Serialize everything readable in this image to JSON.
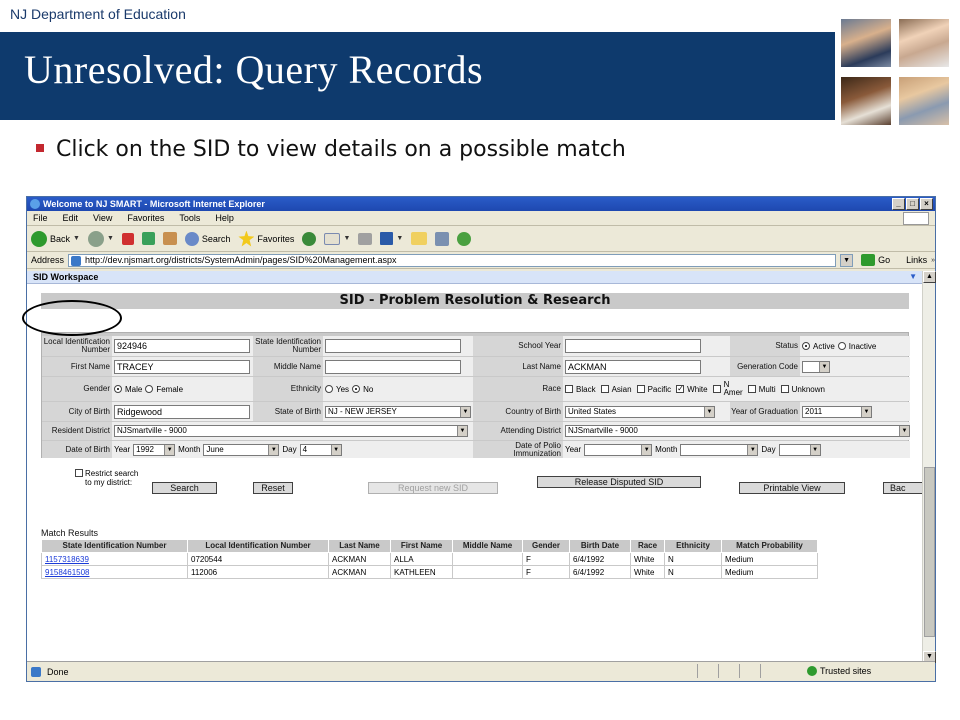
{
  "slide": {
    "header_small": "NJ Department of Education",
    "title": "Unresolved:  Query Records",
    "bullet": "Click on the SID to view details on a possible match"
  },
  "browser": {
    "title": "Welcome to NJ SMART - Microsoft Internet Explorer",
    "window_buttons": [
      "_",
      "□",
      "×"
    ],
    "menu": [
      "File",
      "Edit",
      "View",
      "Favorites",
      "Tools",
      "Help"
    ],
    "toolbar": {
      "back": "Back",
      "search": "Search",
      "favorites": "Favorites"
    },
    "address": {
      "label": "Address",
      "url": "http://dev.njsmart.org/districts/SystemAdmin/pages/SID%20Management.aspx",
      "go": "Go",
      "links": "Links"
    },
    "status": {
      "text": "Done",
      "zone": "Trusted sites"
    }
  },
  "workspace": {
    "bar_title": "SID Workspace",
    "page_title": "SID - Problem Resolution & Research"
  },
  "form": {
    "local_id_label": "Local Identification Number",
    "local_id_value": "924946",
    "state_id_label": "State Identification Number",
    "state_id_value": "",
    "school_year_label": "School Year",
    "school_year_value": "",
    "status_label": "Status",
    "status_active": "Active",
    "status_inactive": "Inactive",
    "first_name_label": "First Name",
    "first_name_value": "TRACEY",
    "middle_name_label": "Middle Name",
    "middle_name_value": "",
    "last_name_label": "Last Name",
    "last_name_value": "ACKMAN",
    "generation_label": "Generation Code",
    "generation_value": "",
    "gender_label": "Gender",
    "gender_male": "Male",
    "gender_female": "Female",
    "ethnicity_label": "Ethnicity",
    "ethnicity_yes": "Yes",
    "ethnicity_no": "No",
    "race_label": "Race",
    "race_black": "Black",
    "race_asian": "Asian",
    "race_pacific": "Pacific",
    "race_white": "White",
    "race_n_amer_1": "N",
    "race_n_amer_2": "Amer",
    "race_multi": "Multi",
    "race_unknown": "Unknown",
    "city_label": "City of Birth",
    "city_value": "Ridgewood",
    "state_birth_label": "State of Birth",
    "state_birth_value": "NJ - NEW JERSEY",
    "country_label": "Country of Birth",
    "country_value": "United States",
    "grad_year_label": "Year of Graduation",
    "grad_year_value": "2011",
    "resident_label": "Resident District",
    "resident_value": "NJSmartville - 9000",
    "attending_label": "Attending District",
    "attending_value": "NJSmartville - 9000",
    "dob_label": "Date of Birth",
    "dob_year_label": "Year",
    "dob_year_value": "1992",
    "dob_month_label": "Month",
    "dob_month_value": "June",
    "dob_day_label": "Day",
    "dob_day_value": "4",
    "polio_label": "Date of Polio Immunization",
    "polio_year_label": "Year",
    "polio_month_label": "Month",
    "polio_day_label": "Day"
  },
  "actions": {
    "restrict_label": "Restrict search to my district:",
    "search": "Search",
    "reset": "Reset",
    "request_new_sid": "Request new SID",
    "release_disputed": "Release Disputed SID",
    "printable_view": "Printable View",
    "back": "Bac"
  },
  "match": {
    "label": "Match Results",
    "headers": [
      "State Identification Number",
      "Local Identification Number",
      "Last Name",
      "First Name",
      "Middle Name",
      "Gender",
      "Birth Date",
      "Race",
      "Ethnicity",
      "Match Probability"
    ],
    "rows": [
      [
        "1157318639",
        "0720544",
        "ACKMAN",
        "ALLA",
        "",
        "F",
        "6/4/1992",
        "White",
        "N",
        "Medium"
      ],
      [
        "9158461508",
        "112006",
        "ACKMAN",
        "KATHLEEN",
        "",
        "F",
        "6/4/1992",
        "White",
        "N",
        "Medium"
      ]
    ]
  }
}
